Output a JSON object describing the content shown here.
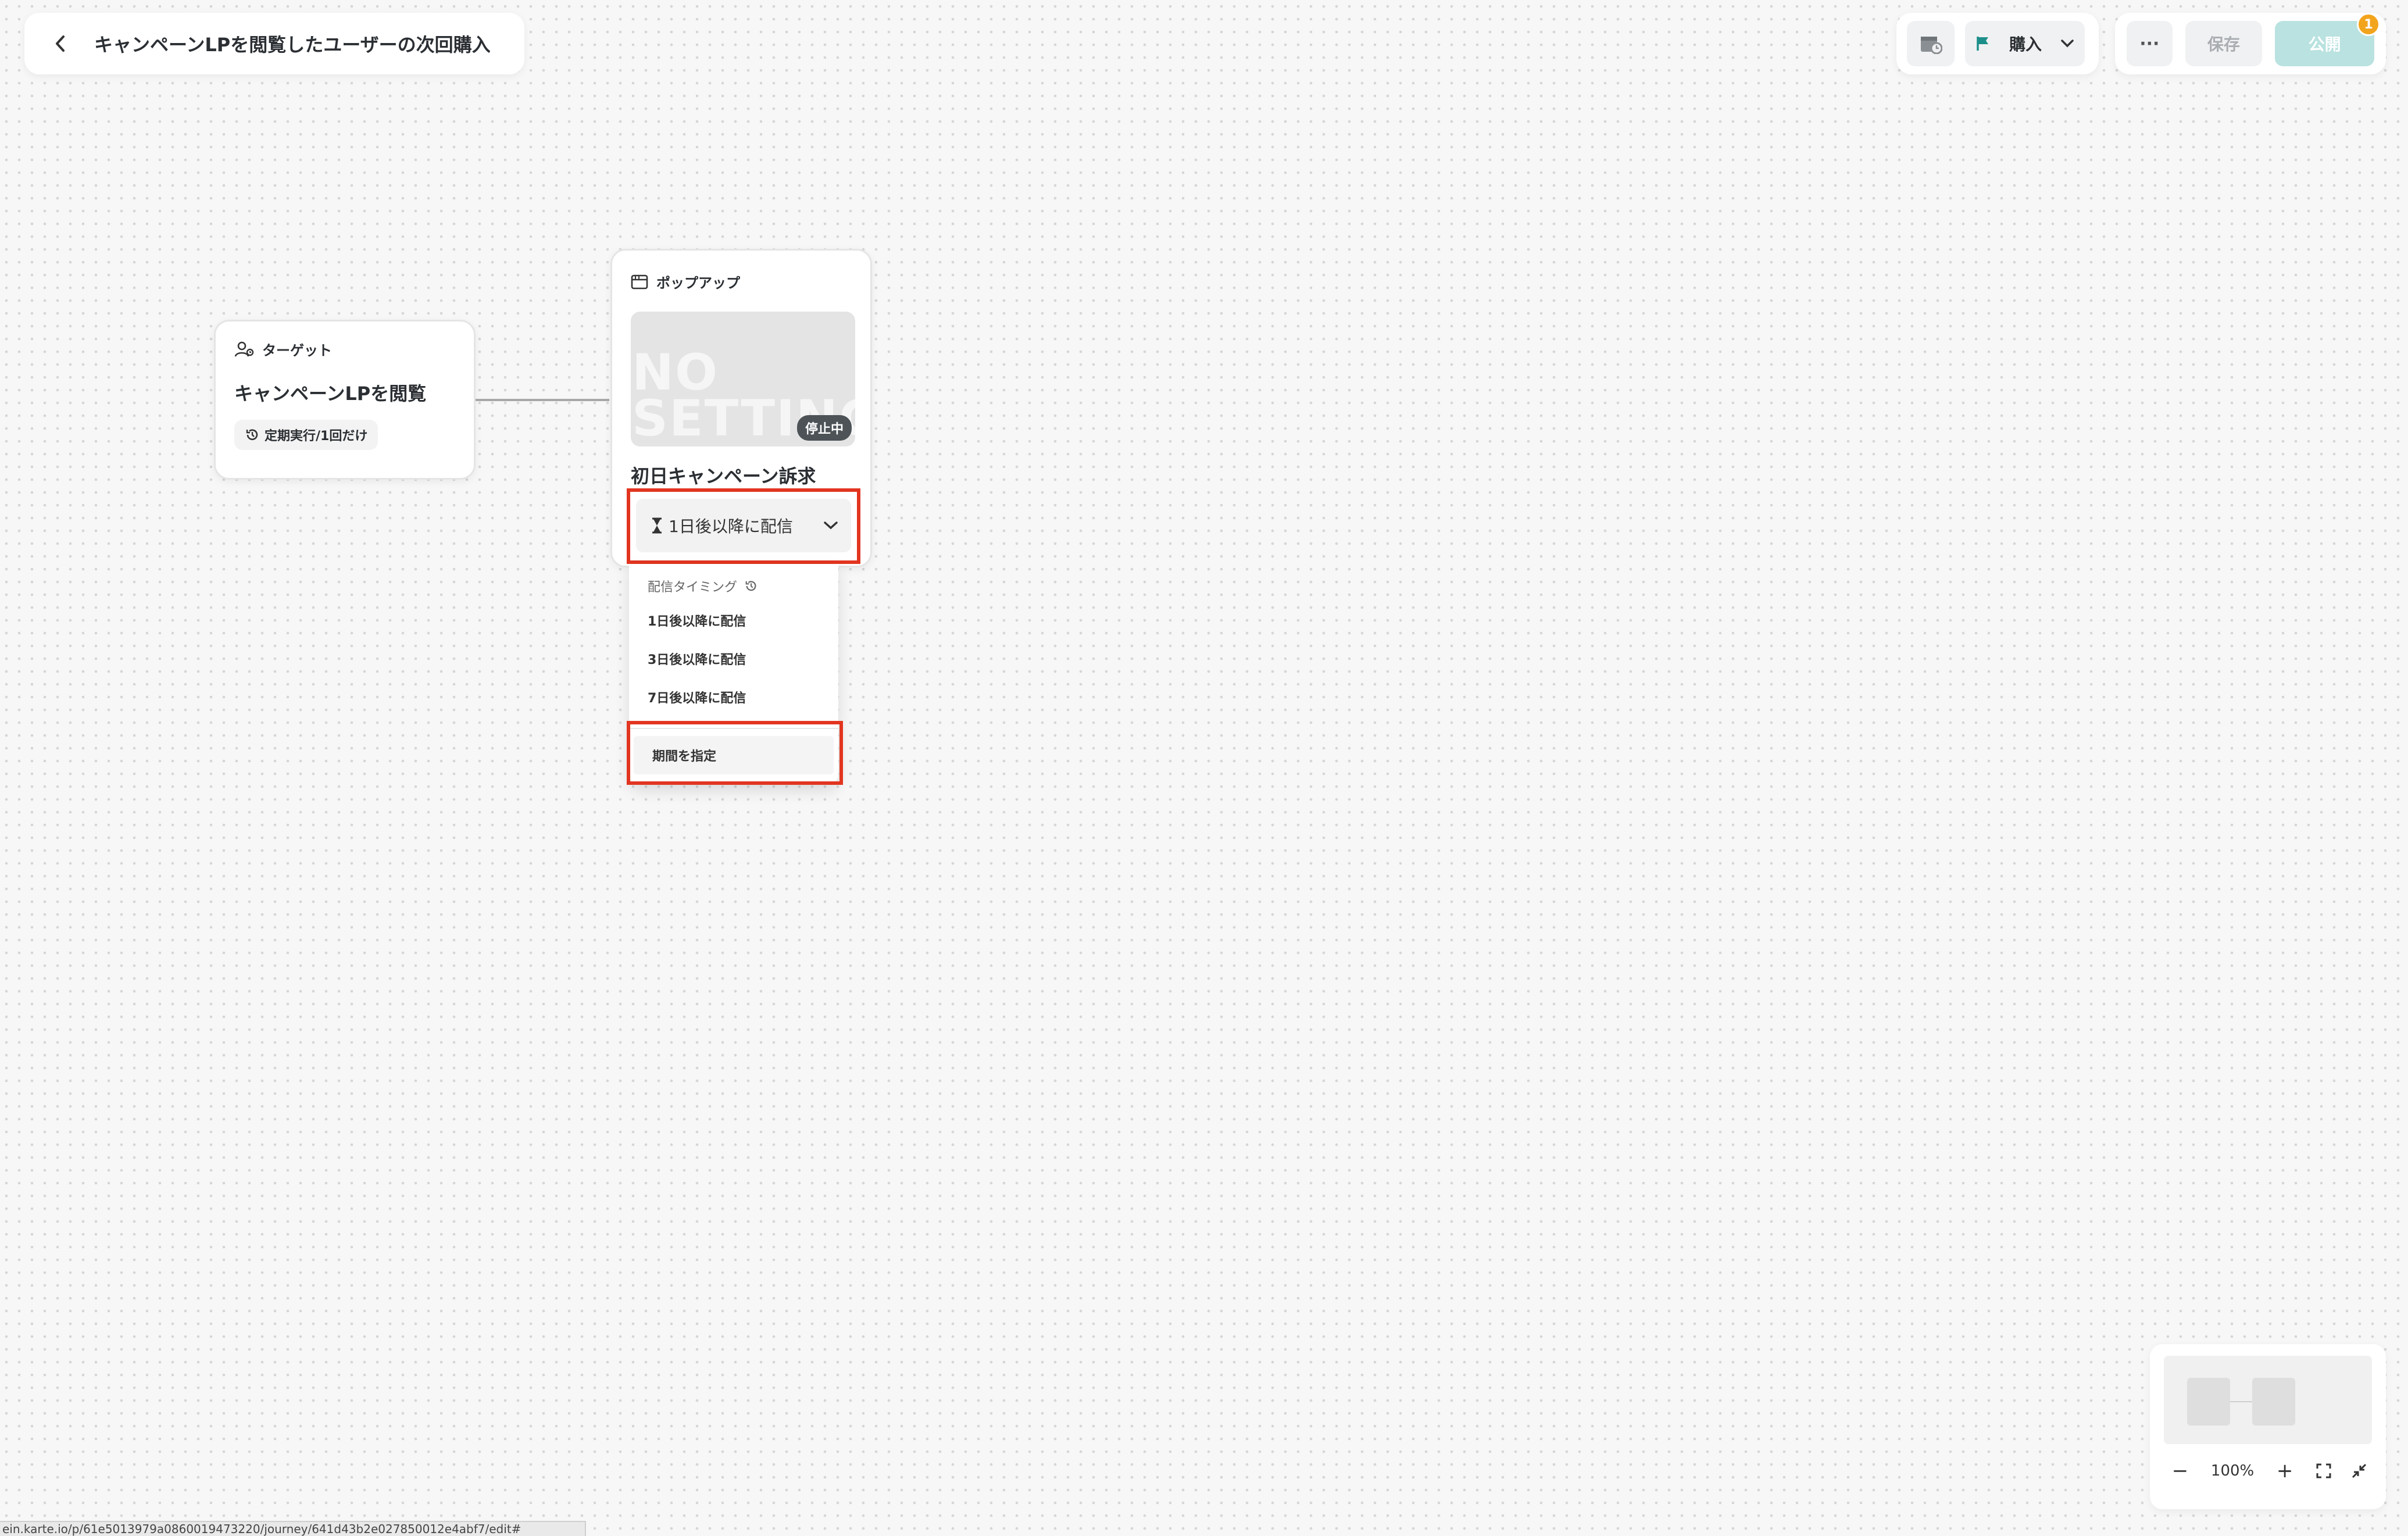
{
  "header": {
    "title": "キャンペーンLPを閲覧したユーザーの次回購入"
  },
  "toolbar": {
    "goal_label": "購入",
    "more_label": "···",
    "save_label": "保存",
    "publish_label": "公開",
    "publish_badge": "1"
  },
  "target_node": {
    "type_label": "ターゲット",
    "title": "キャンペーンLPを閲覧",
    "schedule": "定期実行/1回だけ"
  },
  "popup_node": {
    "type_label": "ポップアップ",
    "thumb_text_line1": "NO",
    "thumb_text_line2": "SETTING",
    "status": "停止中",
    "title": "初日キャンペーン訴求",
    "timing_value": "1日後以降に配信"
  },
  "timing_menu": {
    "header": "配信タイミング",
    "items": [
      "1日後以降に配信",
      "3日後以降に配信",
      "7日後以降に配信"
    ],
    "custom": "期間を指定"
  },
  "minimap": {
    "zoom": "100%"
  },
  "status_bar": {
    "url": "ein.karte.io/p/61e5013979a0860019473220/journey/641d43b2e027850012e4abf7/edit#"
  },
  "colors": {
    "accent": "#1d8f8a",
    "highlight": "#e23520",
    "publish": "#b9e2e0",
    "badge": "#f2a41c"
  }
}
